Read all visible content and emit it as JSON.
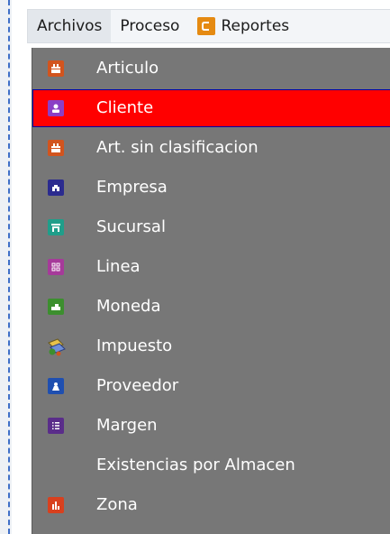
{
  "menubar": {
    "items": [
      {
        "label": "Archivos"
      },
      {
        "label": "Proceso"
      },
      {
        "label": "Reportes"
      }
    ]
  },
  "dropdown": {
    "items": [
      {
        "label": "Articulo",
        "icon": "box-icon",
        "color": "#d2541e"
      },
      {
        "label": "Cliente",
        "icon": "person-icon",
        "color": "#8b3fc6",
        "selected": true
      },
      {
        "label": "Art. sin clasificacion",
        "icon": "box-icon",
        "color": "#d2541e"
      },
      {
        "label": "Empresa",
        "icon": "building-icon",
        "color": "#2b2b8f"
      },
      {
        "label": "Sucursal",
        "icon": "store-icon",
        "color": "#1f9e8a"
      },
      {
        "label": "Linea",
        "icon": "grid-icon",
        "color": "#a63a9a"
      },
      {
        "label": "Moneda",
        "icon": "money-icon",
        "color": "#3c8f2e"
      },
      {
        "label": "Impuesto",
        "icon": "tax-icon",
        "color": "#6f8fd8"
      },
      {
        "label": "Proveedor",
        "icon": "supplier-icon",
        "color": "#1f4fb0"
      },
      {
        "label": "Margen",
        "icon": "list-icon",
        "color": "#5a2d8a"
      },
      {
        "label": "Existencias por Almacen",
        "icon": "",
        "color": ""
      },
      {
        "label": "Zona",
        "icon": "zone-icon",
        "color": "#d8401e"
      }
    ]
  },
  "colors": {
    "menu_bg": "#777777",
    "selected_bg": "#ff0000",
    "selected_border": "#0000a8",
    "reportes_icon": "#e58a12"
  }
}
